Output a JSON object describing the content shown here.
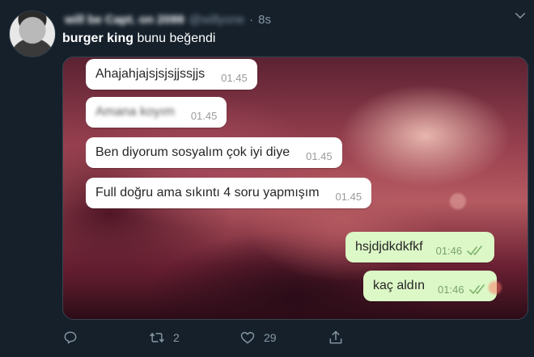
{
  "tweet": {
    "author_name": "will be Capt. on 2099",
    "author_handle": "@willyone",
    "separator": "·",
    "time": "8s",
    "liked_by": "burger king",
    "liked_suffix": "bunu beğendi"
  },
  "chat": {
    "messages": [
      {
        "text": "Ahajahjajsjsjsjjssjjs",
        "time": "01.45",
        "dir": "in"
      },
      {
        "text": "Amana koyım",
        "time": "01.45",
        "dir": "in",
        "blurred": true
      },
      {
        "text": "Ben diyorum sosyalım çok iyi diye",
        "time": "01.45",
        "dir": "in"
      },
      {
        "text": "Full doğru ama sıkıntı 4 soru yapmışım",
        "time": "01.45",
        "dir": "in"
      },
      {
        "text": "hsjdjdkdkfkf",
        "time": "01:46",
        "dir": "out"
      },
      {
        "text": "kaç aldın",
        "time": "01:46",
        "dir": "out"
      }
    ]
  },
  "actions": {
    "reply_count": "",
    "retweet_count": "2",
    "like_count": "29"
  },
  "colors": {
    "background": "#15202b",
    "secondary_text": "#8899a6",
    "incoming_bubble": "#ffffff",
    "outgoing_bubble": "#dcf8c6"
  },
  "icons": [
    "reply-icon",
    "retweet-icon",
    "like-icon",
    "share-icon",
    "chevron-down-icon",
    "double-check-icon"
  ]
}
